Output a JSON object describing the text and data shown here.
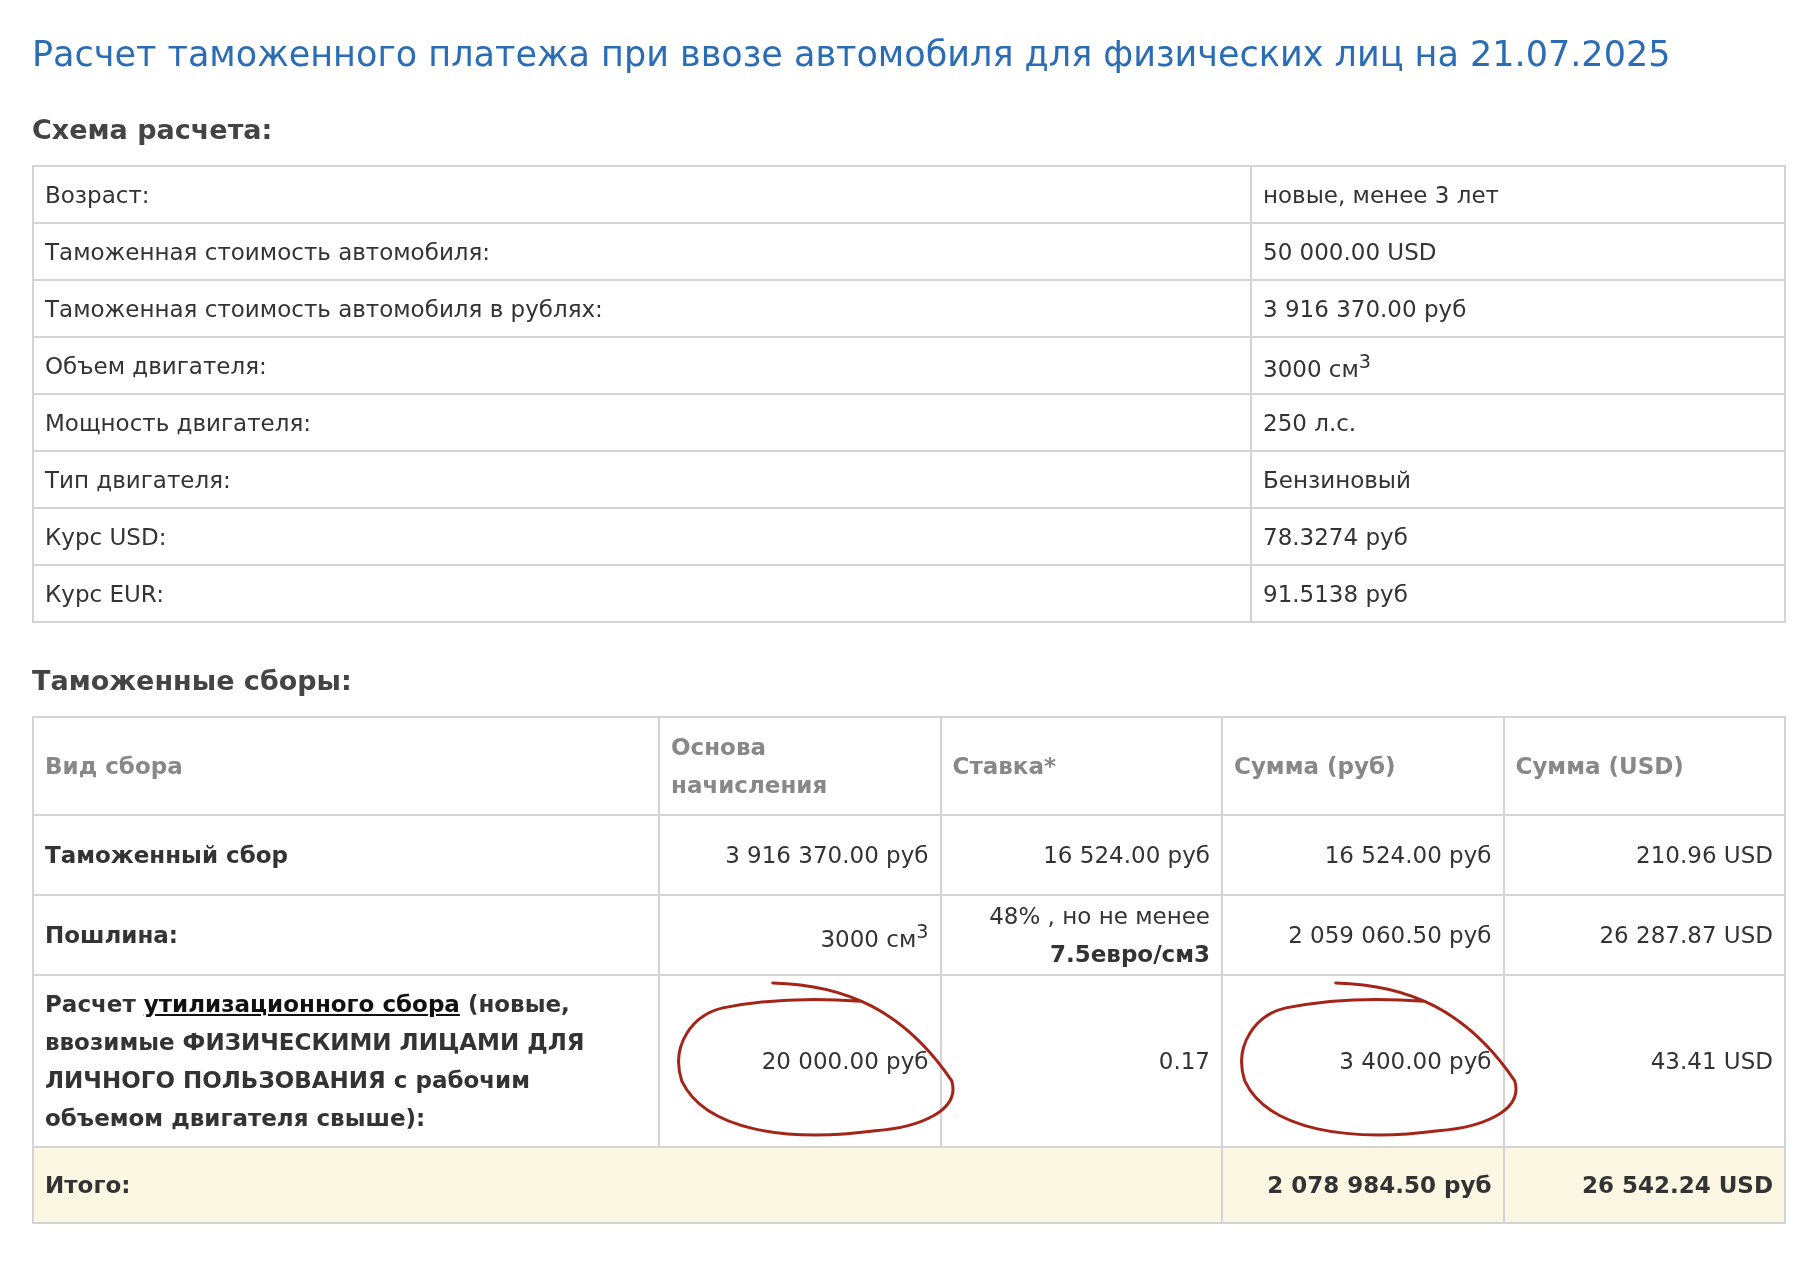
{
  "title": "Расчет таможенного платежа при ввозе автомобиля для физических лиц на 21.07.2025",
  "scheme": {
    "heading": "Схема расчета:",
    "rows": [
      {
        "label": "Возраст:",
        "value": "новые, менее 3 лет"
      },
      {
        "label": "Таможенная стоимость автомобиля:",
        "value": "50 000.00 USD"
      },
      {
        "label": "Таможенная стоимость автомобиля в рублях:",
        "value": "3 916 370.00 руб"
      },
      {
        "label": "Объем двигателя:",
        "value": "3000 см$^{3}$"
      },
      {
        "label": "Мощность двигателя:",
        "value": "250 л.с."
      },
      {
        "label": "Тип двигателя:",
        "value": "Бензиновый"
      },
      {
        "label": "Курс USD:",
        "value": "78.3274 руб"
      },
      {
        "label": "Курс EUR:",
        "value": "91.5138 руб"
      }
    ]
  },
  "fees": {
    "heading": "Таможенные сборы:",
    "columns": [
      "Вид сбора",
      "Основа начисления",
      "Ставка*",
      "Сумма (руб)",
      "Сумма (USD)"
    ],
    "rows": [
      {
        "cells": [
          {
            "kind": "label",
            "text": "Таможенный сбор"
          },
          {
            "kind": "value",
            "text": "3 916 370.00 руб",
            "circled": false
          },
          {
            "kind": "value",
            "text": "16 524.00 руб",
            "circled": false
          },
          {
            "kind": "value",
            "text": "16 524.00 руб",
            "circled": false
          },
          {
            "kind": "value",
            "text": "210.96 USD",
            "circled": false
          }
        ]
      },
      {
        "cells": [
          {
            "kind": "label",
            "text": "Пошлина:"
          },
          {
            "kind": "value",
            "text": "3000 см$^{3}$",
            "circled": false
          },
          {
            "kind": "value",
            "text": "48% , но не менее **7.5евро/см3**",
            "circled": false
          },
          {
            "kind": "value",
            "text": "2 059 060.50 руб",
            "circled": false
          },
          {
            "kind": "value",
            "text": "26 287.87 USD",
            "circled": false
          }
        ]
      },
      {
        "cells": [
          {
            "kind": "link-label",
            "text": "Расчет",
            "link": "утилизационного сбора",
            "suffix": "(новые, ввозимые ФИЗИЧЕСКИМИ ЛИЦАМИ ДЛЯ ЛИЧНОГО ПОЛЬЗОВАНИЯ с рабочим объемом двигателя свыше):"
          },
          {
            "kind": "value",
            "text": "20 000.00 руб",
            "circled": true
          },
          {
            "kind": "value",
            "text": "0.17",
            "circled": false
          },
          {
            "kind": "value",
            "text": "3 400.00 руб",
            "circled": true
          },
          {
            "kind": "value",
            "text": "43.41 USD",
            "circled": false
          }
        ]
      }
    ],
    "total": {
      "label": "Итого:",
      "sum_rub": "2 078 984.50 руб",
      "sum_usd": "26 542.24 USD"
    }
  }
}
